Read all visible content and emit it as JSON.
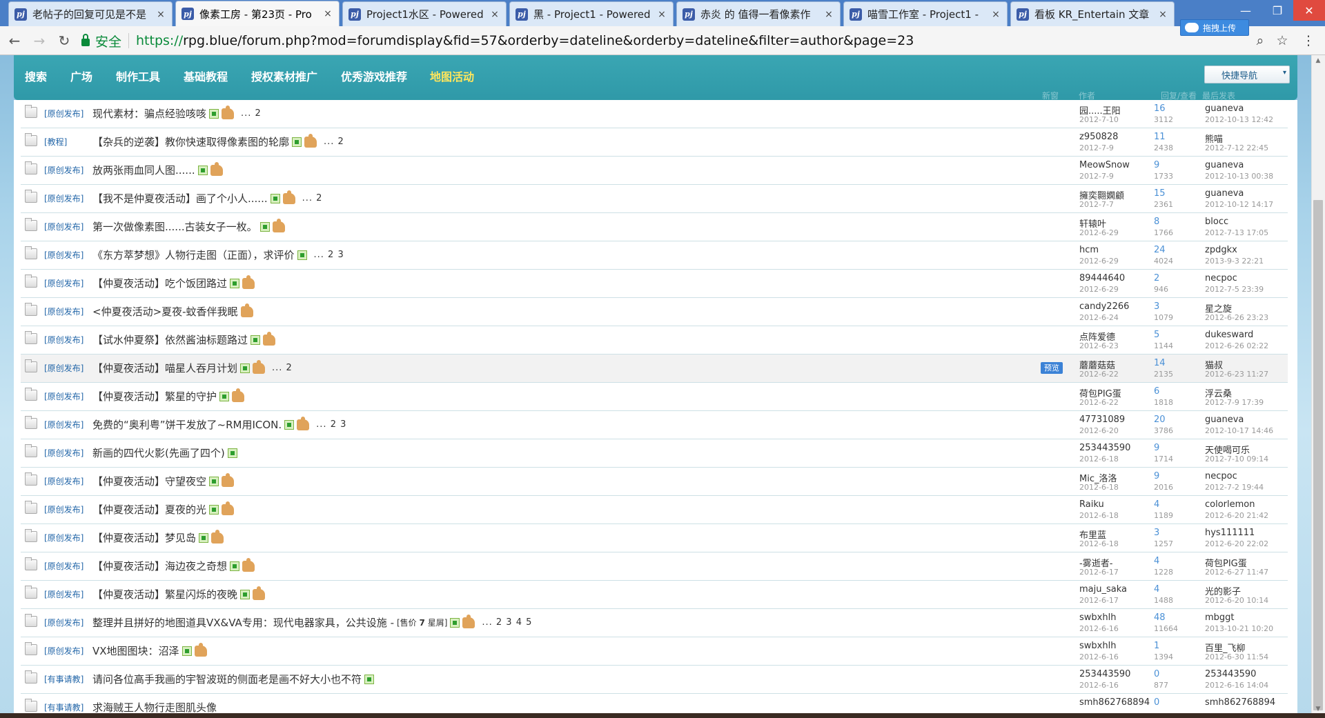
{
  "browser": {
    "tabs": [
      {
        "title": "老帖子的回复可见是不是",
        "active": false
      },
      {
        "title": "像素工房 - 第23页 - Pro",
        "active": true
      },
      {
        "title": "Project1水区 - Powered",
        "active": false
      },
      {
        "title": "黑 - Project1 - Powered",
        "active": false
      },
      {
        "title": "赤炎 的 值得一看像素作",
        "active": false
      },
      {
        "title": "喵雪工作室 - Project1 -",
        "active": false
      },
      {
        "title": "看板 KR_Entertain 文章",
        "active": false
      }
    ],
    "tab_close_glyph": "×",
    "upload_label": "拖拽上传",
    "secure_label": "安全",
    "url_scheme": "https://",
    "url_rest": "rpg.blue/forum.php?mod=forumdisplay&fid=57&orderby=dateline&orderby=dateline&filter=author&page=23",
    "window_buttons": [
      "—",
      "❐",
      "✕"
    ],
    "nav_glyphs": {
      "back": "←",
      "forward": "→",
      "reload": "↻",
      "search": "⌕",
      "star": "☆",
      "menu": "⋮"
    }
  },
  "site_nav": {
    "items": [
      "搜索",
      "广场",
      "制作工具",
      "基础教程",
      "授权素材推广",
      "优秀游戏推荐",
      "地图活动"
    ],
    "quick_nav_label": "快捷导航",
    "quick_nav_caret": "▾",
    "ghost_labels": [
      "新窗",
      "作者",
      "回复/查看",
      "最后发表"
    ]
  },
  "threads": [
    {
      "category": "[原创发布]",
      "title": "现代素材：骗点经验咳咳",
      "img": true,
      "thumb": true,
      "pages": "... 2",
      "author": "园.....王阳",
      "date": "2012-7-10",
      "replies": "16",
      "views": "3112",
      "last_user": "guaneva",
      "last_time": "2012-10-13 12:42"
    },
    {
      "category": "[教程]",
      "title": "【杂兵的逆袭】教你快速取得像素图的轮廓",
      "img": true,
      "thumb": true,
      "pages": "... 2",
      "author": "z950828",
      "date": "2012-7-9",
      "replies": "11",
      "views": "2438",
      "last_user": "熊喵",
      "last_time": "2012-7-12 22:45"
    },
    {
      "category": "[原创发布]",
      "title": "放两张雨血同人图......",
      "img": true,
      "thumb": true,
      "pages": "",
      "author": "MeowSnow",
      "date": "2012-7-9",
      "replies": "9",
      "views": "1733",
      "last_user": "guaneva",
      "last_time": "2012-10-13 00:38"
    },
    {
      "category": "[原创发布]",
      "title": "【我不是仲夏夜活动】画了个小人......",
      "img": true,
      "thumb": true,
      "pages": "... 2",
      "author": "擁奕翾嫻顧",
      "date": "2012-7-7",
      "replies": "15",
      "views": "2361",
      "last_user": "guaneva",
      "last_time": "2012-10-12 14:17"
    },
    {
      "category": "[原创发布]",
      "title": "第一次做像素图......古装女子一枚。",
      "img": true,
      "thumb": true,
      "pages": "",
      "author": "轩辕叶",
      "date": "2012-6-29",
      "replies": "8",
      "views": "1766",
      "last_user": "blocc",
      "last_time": "2012-7-13 17:05"
    },
    {
      "category": "[原创发布]",
      "title": "《东方萃梦想》人物行走图（正面），求评价",
      "img": true,
      "thumb": false,
      "pages": "... 2 3",
      "author": "hcm",
      "date": "2012-6-29",
      "replies": "24",
      "views": "4024",
      "last_user": "zpdgkx",
      "last_time": "2013-9-3 22:21"
    },
    {
      "category": "[原创发布]",
      "title": "【仲夏夜活动】吃个饭团路过",
      "img": true,
      "thumb": true,
      "pages": "",
      "author": "89444640",
      "date": "2012-6-29",
      "replies": "2",
      "views": "946",
      "last_user": "necpoc",
      "last_time": "2012-7-5 23:39"
    },
    {
      "category": "[原创发布]",
      "title": "<仲夏夜活动>夏夜-蚊香伴我眠",
      "img": false,
      "thumb": true,
      "pages": "",
      "author": "candy2266",
      "date": "2012-6-24",
      "replies": "3",
      "views": "1079",
      "last_user": "星之旋",
      "last_time": "2012-6-26 23:23"
    },
    {
      "category": "[原创发布]",
      "title": "【试水仲夏祭】依然酱油标题路过",
      "img": true,
      "thumb": true,
      "pages": "",
      "author": "点阵爱德",
      "date": "2012-6-23",
      "replies": "5",
      "views": "1144",
      "last_user": "dukesward",
      "last_time": "2012-6-26 02:22"
    },
    {
      "category": "[原创发布]",
      "title": "【仲夏夜活动】喵星人吞月计划",
      "img": true,
      "thumb": true,
      "pages": "... 2",
      "author": "蘑蘑菇菇",
      "date": "2012-6-22",
      "replies": "14",
      "views": "2135",
      "last_user": "猫叔",
      "last_time": "2012-6-23 11:27",
      "hover": true,
      "preview": "预览"
    },
    {
      "category": "[原创发布]",
      "title": "【仲夏夜活动】繁星的守护",
      "img": true,
      "thumb": true,
      "pages": "",
      "author": "荷包PIG蛋",
      "date": "2012-6-22",
      "replies": "6",
      "views": "1818",
      "last_user": "浮云桑",
      "last_time": "2012-7-9 17:39"
    },
    {
      "category": "[原创发布]",
      "title": "免费的“奥利粤”饼干发放了~RM用ICON.",
      "img": true,
      "thumb": true,
      "pages": "... 2 3",
      "author": "47731089",
      "date": "2012-6-20",
      "replies": "20",
      "views": "3786",
      "last_user": "guaneva",
      "last_time": "2012-10-17 14:46"
    },
    {
      "category": "[原创发布]",
      "title": "新画的四代火影(先画了四个)",
      "img": true,
      "thumb": false,
      "pages": "",
      "author": "253443590",
      "date": "2012-6-18",
      "replies": "9",
      "views": "1714",
      "last_user": "天使喝可乐",
      "last_time": "2012-7-10 09:14"
    },
    {
      "category": "[原创发布]",
      "title": "【仲夏夜活动】守望夜空",
      "img": true,
      "thumb": true,
      "pages": "",
      "author": "Mic_洛洛",
      "date": "2012-6-18",
      "replies": "9",
      "views": "2016",
      "last_user": "necpoc",
      "last_time": "2012-7-2 19:44"
    },
    {
      "category": "[原创发布]",
      "title": "【仲夏夜活动】夏夜的光",
      "img": true,
      "thumb": true,
      "pages": "",
      "author": "Raiku",
      "date": "2012-6-18",
      "replies": "4",
      "views": "1189",
      "last_user": "colorlemon",
      "last_time": "2012-6-20 21:42"
    },
    {
      "category": "[原创发布]",
      "title": "【仲夏夜活动】梦见岛",
      "img": true,
      "thumb": true,
      "pages": "",
      "author": "布里蓝",
      "date": "2012-6-18",
      "replies": "3",
      "views": "1257",
      "last_user": "hys111111",
      "last_time": "2012-6-20 22:02"
    },
    {
      "category": "[原创发布]",
      "title": "【仲夏夜活动】海边夜之奇想",
      "img": true,
      "thumb": true,
      "pages": "",
      "author": "-雾逝者-",
      "date": "2012-6-17",
      "replies": "4",
      "views": "1228",
      "last_user": "荷包PIG蛋",
      "last_time": "2012-6-27 11:47"
    },
    {
      "category": "[原创发布]",
      "title": "【仲夏夜活动】繁星闪烁的夜晚",
      "img": true,
      "thumb": true,
      "pages": "",
      "author": "maju_saka",
      "date": "2012-6-17",
      "replies": "4",
      "views": "1488",
      "last_user": "光的影子",
      "last_time": "2012-6-20 10:14"
    },
    {
      "category": "[原创发布]",
      "title": "整理并且拼好的地图道具VX&VA专用：现代电器家具，公共设施 -",
      "price_prefix": "[售价",
      "price_value": "7",
      "price_unit": "星屑]",
      "img": true,
      "thumb": true,
      "pages": "... 2 3 4 5",
      "author": "swbxhlh",
      "date": "2012-6-16",
      "replies": "48",
      "views": "11664",
      "last_user": "mbggt",
      "last_time": "2013-10-21 10:20"
    },
    {
      "category": "[原创发布]",
      "title": "VX地图图块：沼泽",
      "img": true,
      "thumb": true,
      "pages": "",
      "author": "swbxhlh",
      "date": "2012-6-16",
      "replies": "1",
      "views": "1394",
      "last_user": "百里_飞柳",
      "last_time": "2012-6-30 11:54"
    },
    {
      "category": "[有事请教]",
      "title": "请问各位高手我画的宇智波斑的侧面老是画不好大小也不符",
      "img": true,
      "thumb": false,
      "pages": "",
      "author": "253443590",
      "date": "2012-6-16",
      "replies": "0",
      "views": "877",
      "last_user": "253443590",
      "last_time": "2012-6-16 14:04"
    },
    {
      "category": "[有事请教]",
      "title": "求海贼王人物行走图肌头像",
      "img": false,
      "thumb": false,
      "pages": "",
      "author": "smh862768894",
      "date": "",
      "replies": "0",
      "views": "",
      "last_user": "smh862768894",
      "last_time": ""
    }
  ],
  "colors": {
    "nav_bar": "#2f99a8",
    "nav_highlight": "#ffe65c",
    "category_link": "#2366a8",
    "reply_count": "#4a90d6",
    "secure_green": "#0a8a3a"
  }
}
